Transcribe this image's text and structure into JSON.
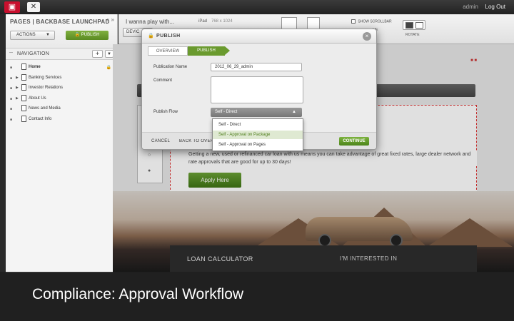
{
  "topbar": {
    "user": "admin",
    "logout_label": "Log Out"
  },
  "leftpanel": {
    "title": "PAGES | BACKBASE LAUNCHPAD",
    "actions_label": "ACTIONS",
    "publish_label": "PUBLISH",
    "navigation_label": "NAVIGATION",
    "items": [
      {
        "label": "Home",
        "active": true
      },
      {
        "label": "Banking Services",
        "active": false
      },
      {
        "label": "Investor Relations",
        "active": false
      },
      {
        "label": "About Us",
        "active": false
      },
      {
        "label": "News and Media",
        "active": false
      },
      {
        "label": "Contact Info",
        "active": false
      }
    ]
  },
  "toolbar": {
    "page_title": "I wanna play with...",
    "device_label": "DEVIC",
    "device_name": "iPad",
    "device_size": "768 x 1024",
    "show_scrollbar_label": "SHOW SCROLLBAR",
    "frame_label": "ME",
    "rotate_label": "ROTATE"
  },
  "canvas": {
    "hero_text": "Getting a new, used or refinanced car loan with us means you can take advantage of great fixed rates, large dealer network and rate approvals that are good for up to 30 days!",
    "apply_label": "Apply Here",
    "calc_label": "LOAN CALCULATOR",
    "interested_label": "I'M INTERESTED IN"
  },
  "modal": {
    "title": "PUBLISH",
    "crumb_overview": "OVERVIEW",
    "crumb_publish": "PUBLISH",
    "publication_name_label": "Publication Name",
    "publication_name_value": "2012_06_29_admin",
    "comment_label": "Comment",
    "publish_flow_label": "Publish Flow",
    "publish_flow_value": "Self - Direct",
    "cancel_label": "CANCEL",
    "back_label": "BACK TO OVERVIEW",
    "continue_label": "CONTINUE",
    "flow_options": [
      {
        "label": "Self - Direct",
        "selected": false
      },
      {
        "label": "Self - Approval on Package",
        "selected": true
      },
      {
        "label": "Self - Approval on Pages",
        "selected": false
      }
    ]
  },
  "caption": {
    "text": "Compliance: Approval Workflow"
  },
  "colors": {
    "accent_green": "#6a9a2e",
    "logo_red": "#c8102e"
  }
}
